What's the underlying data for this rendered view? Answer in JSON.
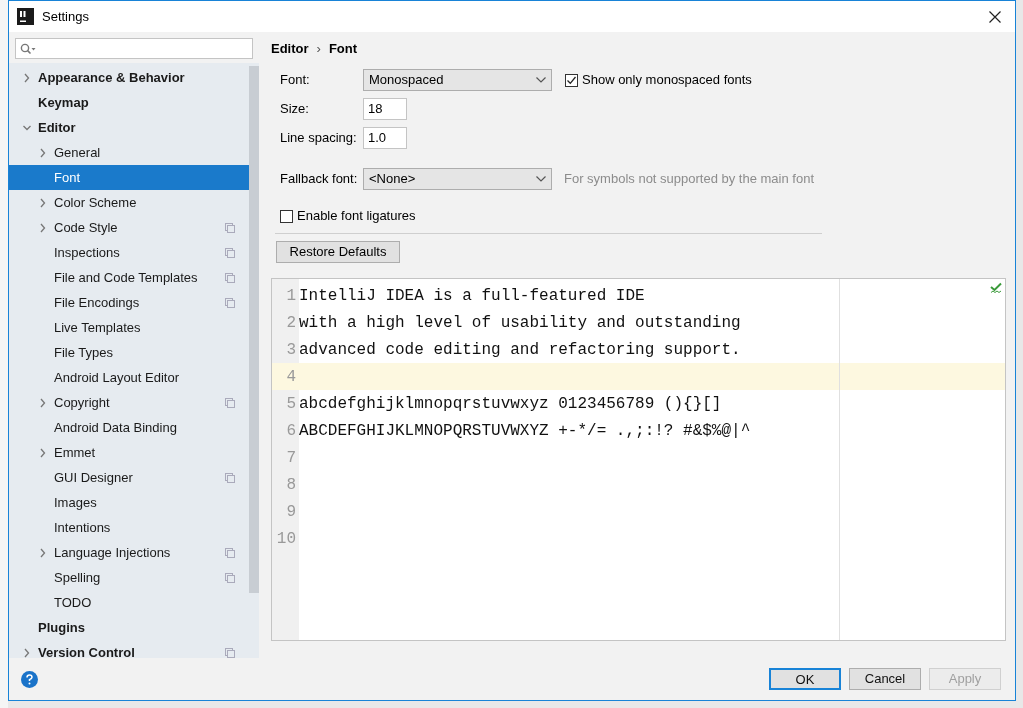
{
  "window": {
    "title": "Settings"
  },
  "sidebar": {
    "items": [
      {
        "label": "Appearance & Behavior",
        "expandable": true,
        "expanded": false,
        "selected": false,
        "shared": false
      },
      {
        "label": "Keymap",
        "expandable": false,
        "selected": false,
        "shared": false
      },
      {
        "label": "Editor",
        "expandable": true,
        "expanded": true,
        "selected": false,
        "shared": false,
        "children": [
          {
            "label": "General",
            "expandable": true,
            "expanded": false,
            "selected": false,
            "shared": false
          },
          {
            "label": "Font",
            "expandable": false,
            "selected": true,
            "shared": false
          },
          {
            "label": "Color Scheme",
            "expandable": true,
            "expanded": false,
            "selected": false,
            "shared": false
          },
          {
            "label": "Code Style",
            "expandable": true,
            "expanded": false,
            "selected": false,
            "shared": true
          },
          {
            "label": "Inspections",
            "expandable": false,
            "selected": false,
            "shared": true
          },
          {
            "label": "File and Code Templates",
            "expandable": false,
            "selected": false,
            "shared": true
          },
          {
            "label": "File Encodings",
            "expandable": false,
            "selected": false,
            "shared": true
          },
          {
            "label": "Live Templates",
            "expandable": false,
            "selected": false,
            "shared": false
          },
          {
            "label": "File Types",
            "expandable": false,
            "selected": false,
            "shared": false
          },
          {
            "label": "Android Layout Editor",
            "expandable": false,
            "selected": false,
            "shared": false
          },
          {
            "label": "Copyright",
            "expandable": true,
            "expanded": false,
            "selected": false,
            "shared": true
          },
          {
            "label": "Android Data Binding",
            "expandable": false,
            "selected": false,
            "shared": false
          },
          {
            "label": "Emmet",
            "expandable": true,
            "expanded": false,
            "selected": false,
            "shared": false
          },
          {
            "label": "GUI Designer",
            "expandable": false,
            "selected": false,
            "shared": true
          },
          {
            "label": "Images",
            "expandable": false,
            "selected": false,
            "shared": false
          },
          {
            "label": "Intentions",
            "expandable": false,
            "selected": false,
            "shared": false
          },
          {
            "label": "Language Injections",
            "expandable": true,
            "expanded": false,
            "selected": false,
            "shared": true
          },
          {
            "label": "Spelling",
            "expandable": false,
            "selected": false,
            "shared": true
          },
          {
            "label": "TODO",
            "expandable": false,
            "selected": false,
            "shared": false
          }
        ]
      },
      {
        "label": "Plugins",
        "expandable": false,
        "selected": false,
        "shared": false
      },
      {
        "label": "Version Control",
        "expandable": true,
        "expanded": false,
        "selected": false,
        "shared": true
      }
    ]
  },
  "breadcrumb": [
    "Editor",
    "›",
    "Font"
  ],
  "form": {
    "font": {
      "label": "Font:",
      "value": "Monospaced"
    },
    "monospaced_only": {
      "label": "Show only monospaced fonts",
      "checked": true
    },
    "size": {
      "label": "Size:",
      "value": "18"
    },
    "line_spacing": {
      "label": "Line spacing:",
      "value": "1.0"
    },
    "fallback_font": {
      "label": "Fallback font:",
      "value": "<None>",
      "hint": "For symbols not supported by the main font"
    },
    "ligatures": {
      "label": "Enable font ligatures",
      "checked": false
    },
    "restore_button": "Restore Defaults"
  },
  "preview": {
    "lines": [
      {
        "number": "1",
        "text": "IntelliJ IDEA is a full-featured IDE",
        "caret": false
      },
      {
        "number": "2",
        "text": "with a high level of usability and outstanding",
        "caret": false
      },
      {
        "number": "3",
        "text": "advanced code editing and refactoring support.",
        "caret": false
      },
      {
        "number": "4",
        "caret": true
      },
      {
        "number": "5",
        "text": "abcdefghijklmnopqrstuvwxyz 0123456789 (){}[]",
        "caret": false
      },
      {
        "number": "6",
        "text": "ABCDEFGHIJKLMNOPQRSTUVWXYZ +-*/= .,;:!? #&$%@|^",
        "caret": false
      },
      {
        "number": "7",
        "caret": false
      },
      {
        "number": "8",
        "caret": false
      },
      {
        "number": "9",
        "caret": false
      },
      {
        "number": "10",
        "caret": false
      }
    ]
  },
  "buttons": [
    {
      "label": "OK",
      "default": true,
      "disabled": false
    },
    {
      "label": "Cancel",
      "default": false,
      "disabled": false
    },
    {
      "label": "Apply",
      "default": false,
      "disabled": true
    }
  ]
}
